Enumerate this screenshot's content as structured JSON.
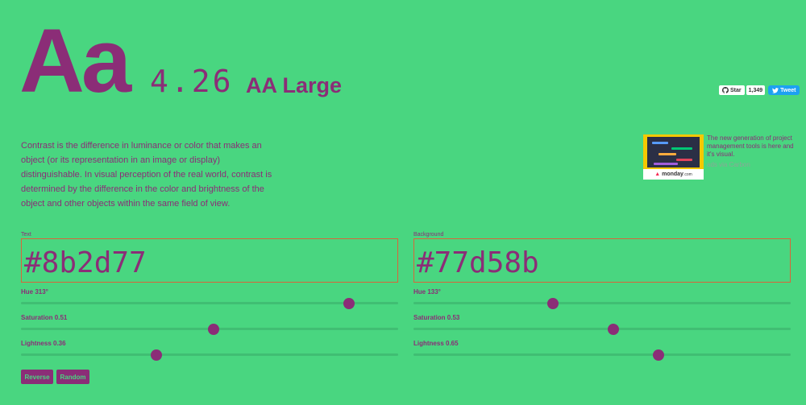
{
  "hero": {
    "sample": "Aa",
    "ratio": "4.26",
    "level": "AA Large"
  },
  "social": {
    "star_label": "Star",
    "star_count": "1,349",
    "tweet_label": "Tweet"
  },
  "description": "Contrast is the difference in luminance or color that makes an object (or its representation in an image or display) distinguishable. In visual perception of the real world, contrast is determined by the difference in the color and brightness of the object and other objects within the same field of view.",
  "ad": {
    "logo_text": "monday",
    "logo_suffix": ".com",
    "text": "The new generation of project management tools is here and it's visual.",
    "via": "ads via Carbon"
  },
  "text_panel": {
    "label": "Text",
    "value": "#8b2d77",
    "hue_label": "Hue 313°",
    "hue_fraction": 0.869,
    "saturation_label": "Saturation 0.51",
    "saturation_fraction": 0.51,
    "lightness_label": "Lightness 0.36",
    "lightness_fraction": 0.36
  },
  "background_panel": {
    "label": "Background",
    "value": "#77d58b",
    "hue_label": "Hue 133°",
    "hue_fraction": 0.369,
    "saturation_label": "Saturation 0.53",
    "saturation_fraction": 0.53,
    "lightness_label": "Lightness 0.65",
    "lightness_fraction": 0.65
  },
  "buttons": {
    "reverse": "Reverse",
    "random": "Random"
  },
  "colors": {
    "text": "#8b2d77",
    "background": "#49d680",
    "input_border": "#d9653a",
    "tweet": "#1da1f2"
  },
  "icons": [
    "github-icon",
    "twitter-icon"
  ]
}
